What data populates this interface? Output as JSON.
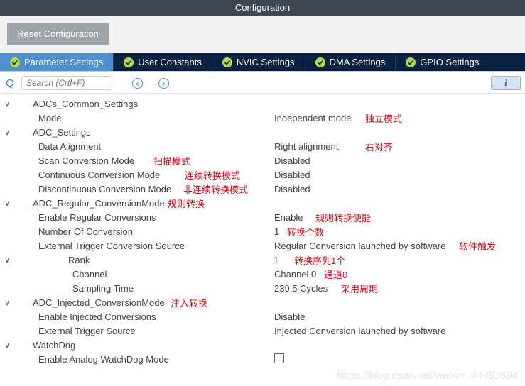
{
  "title": "Configuration",
  "toolbar": {
    "reset_label": "Reset Configuration"
  },
  "tabs": [
    {
      "label": "Parameter Settings",
      "active": true
    },
    {
      "label": "User Constants",
      "active": false
    },
    {
      "label": "NVIC Settings",
      "active": false
    },
    {
      "label": "DMA Settings",
      "active": false
    },
    {
      "label": "GPIO Settings",
      "active": false
    }
  ],
  "search": {
    "icon": "Q",
    "placeholder": "Search (Crtl+F)",
    "prev": "‹",
    "next": "›",
    "info": "i"
  },
  "tree": {
    "s0": {
      "header": "ADCs_Common_Settings",
      "r0": {
        "label": "Mode",
        "value": "Independent mode",
        "ann": "独立模式"
      }
    },
    "s1": {
      "header": "ADC_Settings",
      "r0": {
        "label": "Data Alignment",
        "value": "Right alignment",
        "ann": "右对齐"
      },
      "r1": {
        "label": "Scan Conversion Mode",
        "value": "Disabled",
        "ann": "扫描模式"
      },
      "r2": {
        "label": "Continuous Conversion Mode",
        "value": "Disabled",
        "ann": "连续转换模式"
      },
      "r3": {
        "label": "Discontinuous Conversion Mode",
        "value": "Disabled",
        "ann": "非连续转换模式"
      }
    },
    "s2": {
      "header": "ADC_Regular_ConversionMode",
      "ann": "规则转换",
      "r0": {
        "label": "Enable Regular Conversions",
        "value": "Enable",
        "ann": "规则转换使能"
      },
      "r1": {
        "label": "Number Of Conversion",
        "value": "1",
        "ann": "转换个数"
      },
      "r2": {
        "label": "External Trigger Conversion Source",
        "value": "Regular Conversion launched by software",
        "ann": "软件触发"
      },
      "rank": {
        "label": "Rank",
        "value": "1",
        "ann": "转换序列1个",
        "c0": {
          "label": "Channel",
          "value": "Channel 0",
          "ann": "通道0"
        },
        "c1": {
          "label": "Sampling Time",
          "value": "239.5 Cycles",
          "ann": "采用周期"
        }
      }
    },
    "s3": {
      "header": "ADC_Injected_ConversionMode",
      "ann": "注入转换",
      "r0": {
        "label": "Enable Injected Conversions",
        "value": "Disable"
      },
      "r1": {
        "label": "External Trigger Source",
        "value": "Injected Conversion launched by software"
      }
    },
    "s4": {
      "header": "WatchDog",
      "r0": {
        "label": "Enable Analog WatchDog Mode"
      }
    }
  },
  "watermark": "https://blog.csdn.net/weixin_44453694"
}
